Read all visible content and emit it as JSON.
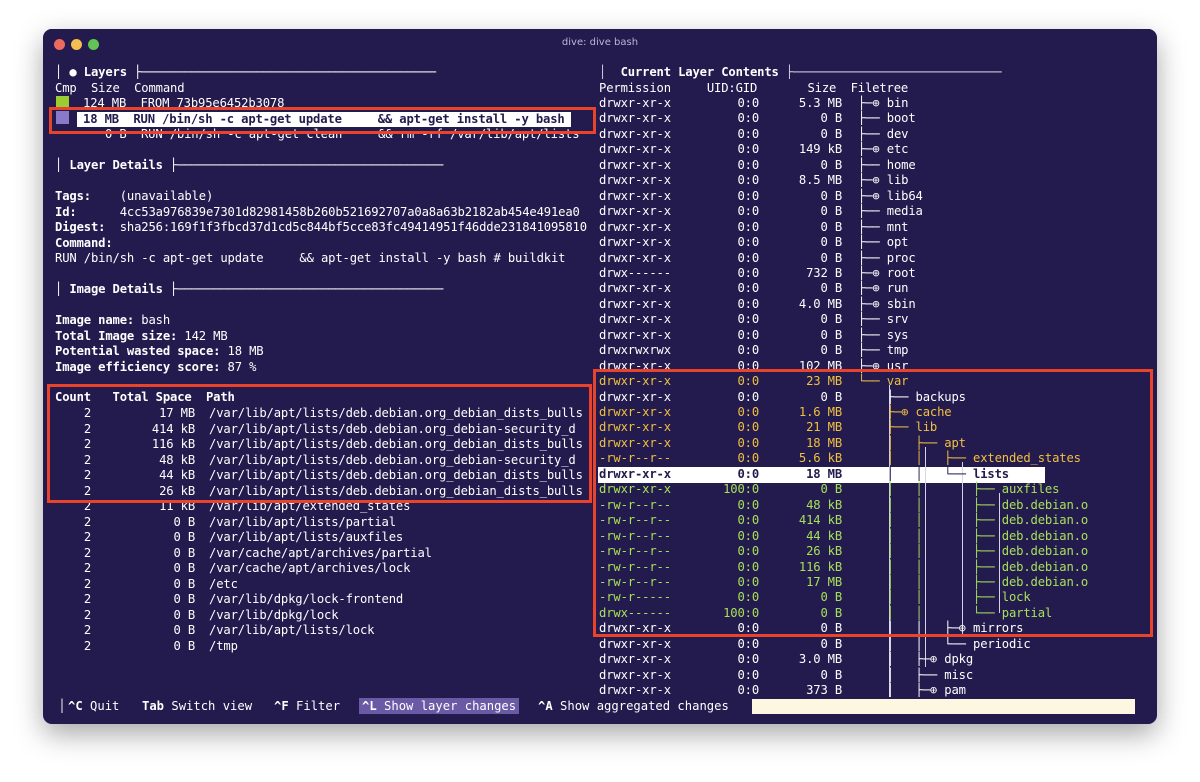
{
  "window": {
    "title": "dive: dive bash"
  },
  "layers": {
    "header": "│ ● Layers ├─────────────────────────────────────────",
    "col_header": "Cmp  Size  Command",
    "rows": [
      {
        "size": "124 MB",
        "command": "FROM 73b95e6452b3078"
      },
      {
        "size": "18 MB",
        "command": "RUN /bin/sh -c apt-get update     && apt-get install -y bash"
      },
      {
        "size": "0 B",
        "command": "RUN /bin/sh -c apt-get clean     && rm -rf /var/lib/apt/lists"
      }
    ],
    "swatch_colors": [
      "#9acd32",
      "#8a78c8"
    ]
  },
  "layer_details": {
    "header": "│ Layer Details ├─────────────────────────────────────",
    "tags_label": "Tags:",
    "tags": "(unavailable)",
    "id_label": "Id:",
    "id": "4cc53a976839e7301d82981458b260b521692707a0a8a63b2182ab454e491ea0",
    "digest_label": "Digest:",
    "digest": "sha256:169f1f3fbcd37d1cd5c844bf5cce83fc49414951f46dde231841095810",
    "command_label": "Command:",
    "command": "RUN /bin/sh -c apt-get update     && apt-get install -y bash # buildkit"
  },
  "image_details": {
    "header": "│ Image Details ├─────────────────────────────────────",
    "name_label": "Image name:",
    "name": "bash",
    "size_label": "Total Image size:",
    "size": "142 MB",
    "wasted_label": "Potential wasted space:",
    "wasted": "18 MB",
    "efficiency_label": "Image efficiency score:",
    "efficiency": "87 %",
    "table_header": "Count   Total Space  Path",
    "rows": [
      {
        "count": "2",
        "space": "17 MB",
        "path": "/var/lib/apt/lists/deb.debian.org_debian_dists_bulls"
      },
      {
        "count": "2",
        "space": "414 kB",
        "path": "/var/lib/apt/lists/deb.debian.org_debian-security_d"
      },
      {
        "count": "2",
        "space": "116 kB",
        "path": "/var/lib/apt/lists/deb.debian.org_debian_dists_bulls"
      },
      {
        "count": "2",
        "space": "48 kB",
        "path": "/var/lib/apt/lists/deb.debian.org_debian-security_d"
      },
      {
        "count": "2",
        "space": "44 kB",
        "path": "/var/lib/apt/lists/deb.debian.org_debian_dists_bulls"
      },
      {
        "count": "2",
        "space": "26 kB",
        "path": "/var/lib/apt/lists/deb.debian.org_debian_dists_bulls"
      },
      {
        "count": "2",
        "space": "11 kB",
        "path": "/var/lib/apt/extended_states"
      },
      {
        "count": "2",
        "space": "0 B",
        "path": "/var/lib/apt/lists/partial"
      },
      {
        "count": "2",
        "space": "0 B",
        "path": "/var/lib/apt/lists/auxfiles"
      },
      {
        "count": "2",
        "space": "0 B",
        "path": "/var/cache/apt/archives/partial"
      },
      {
        "count": "2",
        "space": "0 B",
        "path": "/var/cache/apt/archives/lock"
      },
      {
        "count": "2",
        "space": "0 B",
        "path": "/etc"
      },
      {
        "count": "2",
        "space": "0 B",
        "path": "/var/lib/dpkg/lock-frontend"
      },
      {
        "count": "2",
        "space": "0 B",
        "path": "/var/lib/dpkg/lock"
      },
      {
        "count": "2",
        "space": "0 B",
        "path": "/var/lib/apt/lists/lock"
      },
      {
        "count": "2",
        "space": "0 B",
        "path": "/tmp"
      }
    ]
  },
  "contents": {
    "header_prefix": "│",
    "header_title": "Current Layer Contents",
    "header_suffix": "├─────────────────────────────",
    "col_header": "Permission     UID:GID       Size  Filetree",
    "rows": [
      {
        "perm": "drwxr-xr-x",
        "uid": "0:0",
        "size": "5.3 MB",
        "tree": "├─⊕ bin",
        "style": ""
      },
      {
        "perm": "drwxr-xr-x",
        "uid": "0:0",
        "size": "0 B",
        "tree": "├── boot",
        "style": ""
      },
      {
        "perm": "drwxr-xr-x",
        "uid": "0:0",
        "size": "0 B",
        "tree": "├── dev",
        "style": ""
      },
      {
        "perm": "drwxr-xr-x",
        "uid": "0:0",
        "size": "149 kB",
        "tree": "├─⊕ etc",
        "style": ""
      },
      {
        "perm": "drwxr-xr-x",
        "uid": "0:0",
        "size": "0 B",
        "tree": "├── home",
        "style": ""
      },
      {
        "perm": "drwxr-xr-x",
        "uid": "0:0",
        "size": "8.5 MB",
        "tree": "├─⊕ lib",
        "style": ""
      },
      {
        "perm": "drwxr-xr-x",
        "uid": "0:0",
        "size": "0 B",
        "tree": "├─⊕ lib64",
        "style": ""
      },
      {
        "perm": "drwxr-xr-x",
        "uid": "0:0",
        "size": "0 B",
        "tree": "├── media",
        "style": ""
      },
      {
        "perm": "drwxr-xr-x",
        "uid": "0:0",
        "size": "0 B",
        "tree": "├── mnt",
        "style": ""
      },
      {
        "perm": "drwxr-xr-x",
        "uid": "0:0",
        "size": "0 B",
        "tree": "├── opt",
        "style": ""
      },
      {
        "perm": "drwxr-xr-x",
        "uid": "0:0",
        "size": "0 B",
        "tree": "├── proc",
        "style": ""
      },
      {
        "perm": "drwx------",
        "uid": "0:0",
        "size": "732 B",
        "tree": "├─⊕ root",
        "style": ""
      },
      {
        "perm": "drwxr-xr-x",
        "uid": "0:0",
        "size": "0 B",
        "tree": "├─⊕ run",
        "style": ""
      },
      {
        "perm": "drwxr-xr-x",
        "uid": "0:0",
        "size": "4.0 MB",
        "tree": "├─⊕ sbin",
        "style": ""
      },
      {
        "perm": "drwxr-xr-x",
        "uid": "0:0",
        "size": "0 B",
        "tree": "├── srv",
        "style": ""
      },
      {
        "perm": "drwxr-xr-x",
        "uid": "0:0",
        "size": "0 B",
        "tree": "├── sys",
        "style": ""
      },
      {
        "perm": "drwxrwxrwx",
        "uid": "0:0",
        "size": "0 B",
        "tree": "├── tmp",
        "style": ""
      },
      {
        "perm": "drwxr-xr-x",
        "uid": "0:0",
        "size": "102 MB",
        "tree": "├─⊕ usr",
        "style": ""
      },
      {
        "perm": "drwxr-xr-x",
        "uid": "0:0",
        "size": "23 MB",
        "tree": "└── var",
        "style": "y"
      },
      {
        "perm": "drwxr-xr-x",
        "uid": "0:0",
        "size": "0 B",
        "tree": "    ├── backups",
        "style": ""
      },
      {
        "perm": "drwxr-xr-x",
        "uid": "0:0",
        "size": "1.6 MB",
        "tree": "    ├─⊕ cache",
        "style": "y"
      },
      {
        "perm": "drwxr-xr-x",
        "uid": "0:0",
        "size": "21 MB",
        "tree": "    ├── lib",
        "style": "y"
      },
      {
        "perm": "drwxr-xr-x",
        "uid": "0:0",
        "size": "18 MB",
        "tree": "    │   ├── apt",
        "style": "y"
      },
      {
        "perm": "-rw-r--r--",
        "uid": "0:0",
        "size": "5.6 kB",
        "tree": "    │   │   ├── extended_states",
        "style": "y"
      },
      {
        "perm": "drwxr-xr-x",
        "uid": "0:0",
        "size": "18 MB",
        "tree": "    │   │   └── lists",
        "style": "sel"
      },
      {
        "perm": "drwxr-xr-x",
        "uid": "100:0",
        "size": "0 B",
        "tree": "    │   │       ├── auxfiles",
        "style": "g"
      },
      {
        "perm": "-rw-r--r--",
        "uid": "0:0",
        "size": "48 kB",
        "tree": "    │   │       ├── deb.debian.o",
        "style": "g"
      },
      {
        "perm": "-rw-r--r--",
        "uid": "0:0",
        "size": "414 kB",
        "tree": "    │   │       ├── deb.debian.o",
        "style": "g"
      },
      {
        "perm": "-rw-r--r--",
        "uid": "0:0",
        "size": "44 kB",
        "tree": "    │   │       ├── deb.debian.o",
        "style": "g"
      },
      {
        "perm": "-rw-r--r--",
        "uid": "0:0",
        "size": "26 kB",
        "tree": "    │   │       ├── deb.debian.o",
        "style": "g"
      },
      {
        "perm": "-rw-r--r--",
        "uid": "0:0",
        "size": "116 kB",
        "tree": "    │   │       ├── deb.debian.o",
        "style": "g"
      },
      {
        "perm": "-rw-r--r--",
        "uid": "0:0",
        "size": "17 MB",
        "tree": "    │   │       ├── deb.debian.o",
        "style": "g"
      },
      {
        "perm": "-rw-r-----",
        "uid": "0:0",
        "size": "0 B",
        "tree": "    │   │       ├── lock",
        "style": "g"
      },
      {
        "perm": "drwx------",
        "uid": "100:0",
        "size": "0 B",
        "tree": "    │   │       └── partial",
        "style": "g"
      },
      {
        "perm": "drwxr-xr-x",
        "uid": "0:0",
        "size": "0 B",
        "tree": "    │   │   ├─⊕ mirrors",
        "style": ""
      },
      {
        "perm": "drwxr-xr-x",
        "uid": "0:0",
        "size": "0 B",
        "tree": "    │   │   └── periodic",
        "style": ""
      },
      {
        "perm": "drwxr-xr-x",
        "uid": "0:0",
        "size": "3.0 MB",
        "tree": "    │   ├─⊕ dpkg",
        "style": ""
      },
      {
        "perm": "drwxr-xr-x",
        "uid": "0:0",
        "size": "0 B",
        "tree": "    │   ├── misc",
        "style": ""
      },
      {
        "perm": "drwxr-xr-x",
        "uid": "0:0",
        "size": "373 B",
        "tree": "    │   ├─⊕ pam",
        "style": ""
      }
    ]
  },
  "keybar": [
    {
      "key": "^C",
      "label": "Quit",
      "active": false
    },
    {
      "key": "Tab",
      "label": "Switch view",
      "active": false
    },
    {
      "key": "^F",
      "label": "Filter",
      "active": false
    },
    {
      "key": "^L",
      "label": "Show layer changes",
      "active": true
    },
    {
      "key": "^A",
      "label": "Show aggregated changes",
      "active": false
    }
  ]
}
